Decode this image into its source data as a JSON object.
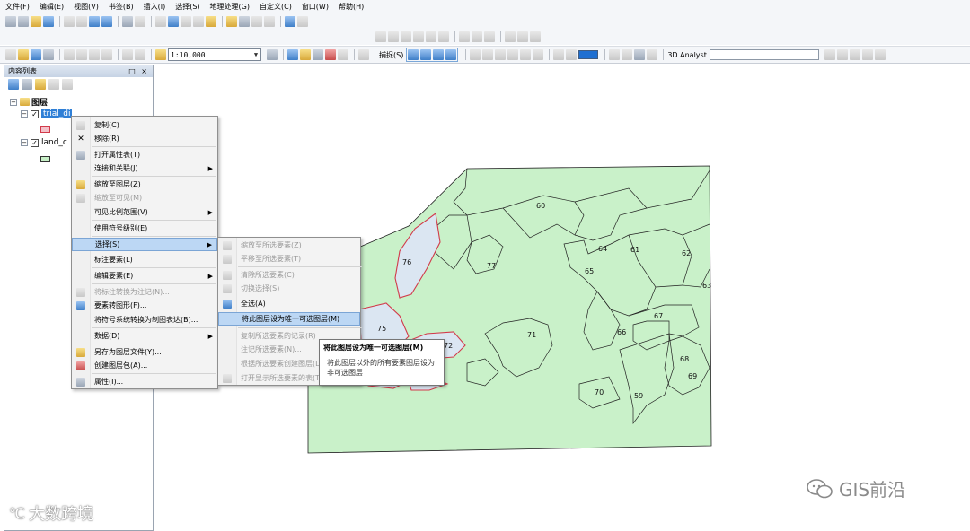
{
  "menubar": {
    "items": [
      "文件(F)",
      "编辑(E)",
      "视图(V)",
      "书签(B)",
      "插入(I)",
      "选择(S)",
      "地理处理(G)",
      "自定义(C)",
      "窗口(W)",
      "帮助(H)"
    ]
  },
  "toolbar": {
    "scale_value": "1:10,000",
    "snapping_label": "捕捉(S)",
    "analyst_label": "3D Analyst",
    "accent_color": "#1f6fd1"
  },
  "toc": {
    "title": "内容列表",
    "controls": "□ ×",
    "root_label": "图层",
    "layers": [
      {
        "name": "trial_di",
        "checked": "✓",
        "symbol_color": "#f3c1c9"
      },
      {
        "name": "land_c",
        "checked": "✓",
        "symbol_color": "#c7f0c7"
      }
    ]
  },
  "context_menu": {
    "items": [
      {
        "label": "复制(C)",
        "icon": "copy-icon"
      },
      {
        "label": "移除(R)",
        "icon": "close-icon"
      },
      {
        "label": "打开属性表(T)",
        "icon": "table-icon"
      },
      {
        "label": "连接和关联(J)",
        "icon": "none"
      },
      {
        "label": "缩放至图层(Z)",
        "icon": "zoom-layer-icon"
      },
      {
        "label": "缩放至可见(M)",
        "icon": "zoom-visible-icon"
      },
      {
        "label": "可见比例范围(V)",
        "icon": "none"
      },
      {
        "label": "使用符号级别(E)",
        "icon": "none"
      },
      {
        "label": "选择(S)",
        "icon": "none"
      },
      {
        "label": "标注要素(L)",
        "icon": "none"
      },
      {
        "label": "编辑要素(E)",
        "icon": "none"
      },
      {
        "label": "将标注转换为注记(N)...",
        "icon": "convert-label-icon"
      },
      {
        "label": "要素转图形(F)...",
        "icon": "feature-graphic-icon"
      },
      {
        "label": "将符号系统转换为制图表达(B)...",
        "icon": "none"
      },
      {
        "label": "数据(D)",
        "icon": "none"
      },
      {
        "label": "另存为图层文件(Y)...",
        "icon": "save-layer-icon"
      },
      {
        "label": "创建图层包(A)...",
        "icon": "layer-package-icon"
      },
      {
        "label": "属性(I)...",
        "icon": "properties-icon"
      }
    ]
  },
  "submenu": {
    "items": [
      {
        "label": "缩放至所选要素(Z)"
      },
      {
        "label": "平移至所选要素(T)"
      },
      {
        "label": "清除所选要素(C)"
      },
      {
        "label": "切换选择(S)"
      },
      {
        "label": "全选(A)"
      },
      {
        "label": "将此图层设为唯一可选图层(M)"
      },
      {
        "label": "复制所选要素的记录(R)"
      },
      {
        "label": "注记所选要素(N)..."
      },
      {
        "label": "根据所选要素创建图层(L)"
      },
      {
        "label": "打开显示所选要素的表(T)"
      }
    ]
  },
  "tooltip": {
    "title": "将此图层设为唯一可选图层(M)",
    "line1": "将此图层以外的所有要素图层设为",
    "line2": "非可选图层"
  },
  "map": {
    "labels": [
      "60",
      "64",
      "61",
      "62",
      "77",
      "76",
      "65",
      "63",
      "67",
      "66",
      "71",
      "75",
      "72",
      "68",
      "69",
      "70",
      "59"
    ],
    "land_color": "#c9f1c9",
    "selection_color": "#d23a4a"
  },
  "watermarks": {
    "left": "大数跨境",
    "right": "GIS前沿"
  }
}
